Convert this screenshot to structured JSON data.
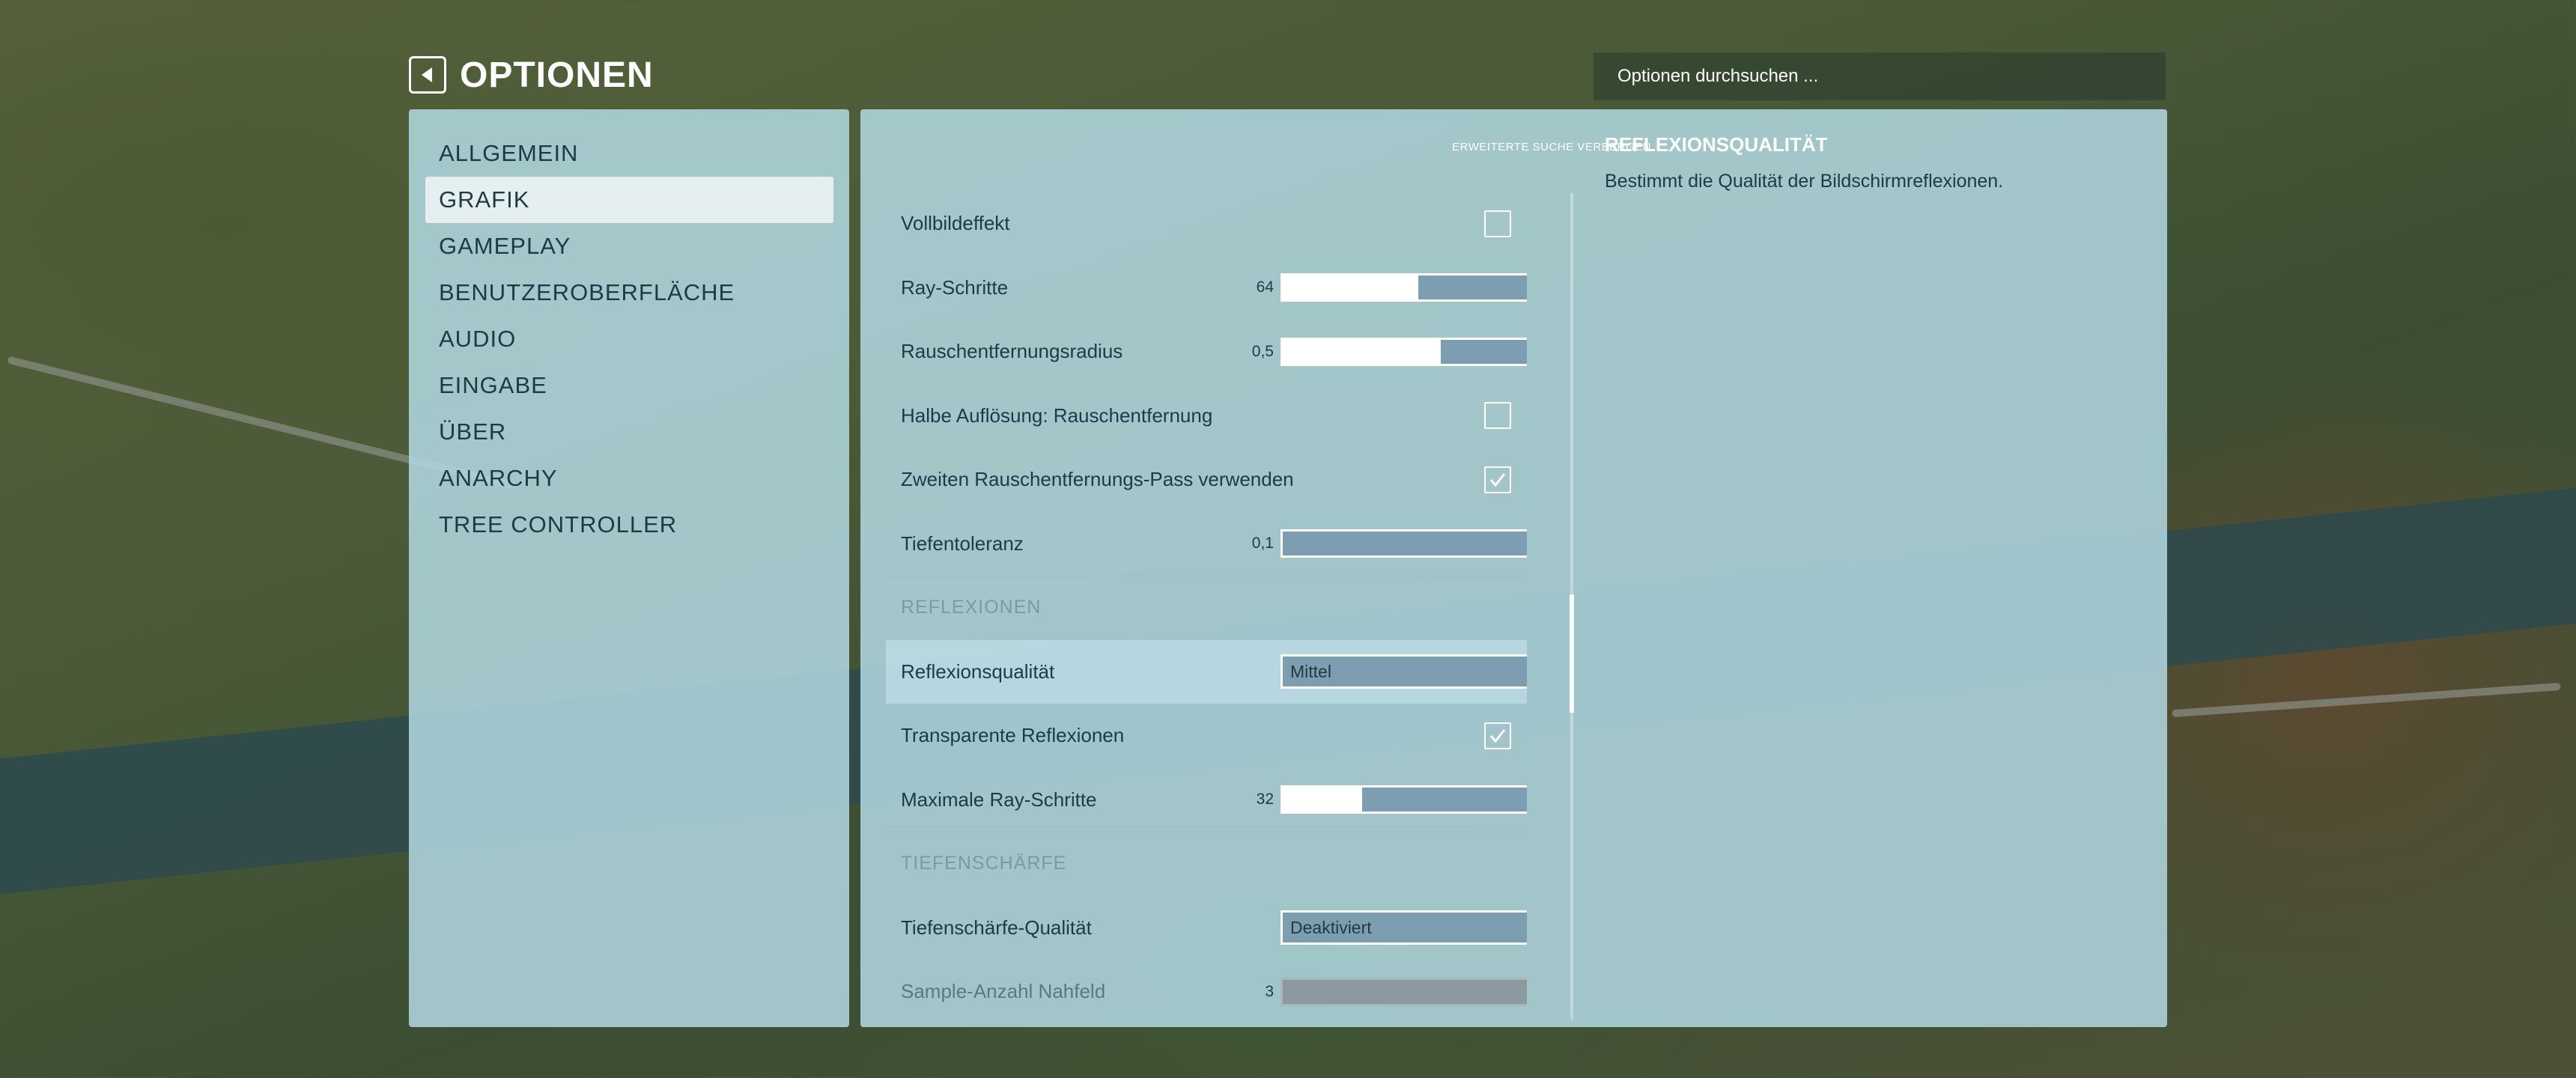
{
  "header": {
    "title": "OPTIONEN",
    "back_icon": "back-arrow-icon",
    "search_placeholder": "Optionen durchsuchen ..."
  },
  "sidebar": {
    "items": [
      {
        "label": "ALLGEMEIN",
        "active": false
      },
      {
        "label": "GRAFIK",
        "active": true
      },
      {
        "label": "GAMEPLAY",
        "active": false
      },
      {
        "label": "BENUTZEROBERFLÄCHE",
        "active": false
      },
      {
        "label": "AUDIO",
        "active": false
      },
      {
        "label": "EINGABE",
        "active": false
      },
      {
        "label": "ÜBER",
        "active": false
      },
      {
        "label": "ANARCHY",
        "active": false
      },
      {
        "label": "TREE CONTROLLER",
        "active": false
      }
    ]
  },
  "main": {
    "advanced_link": "ERWEITERTE SUCHE VERBERGEN",
    "settings": [
      {
        "type": "checkbox",
        "label": "Vollbildeffekt",
        "checked": false
      },
      {
        "type": "slider",
        "label": "Ray-Schritte",
        "value": "64",
        "fraction": 0.43
      },
      {
        "type": "slider",
        "label": "Rauschentfernungsradius",
        "value": "0,5",
        "fraction": 0.5
      },
      {
        "type": "checkbox",
        "label": "Halbe Auflösung: Rauschentfernung",
        "checked": false
      },
      {
        "type": "checkbox",
        "label": "Zweiten Rauschentfernungs-Pass verwenden",
        "checked": true
      },
      {
        "type": "slider",
        "label": "Tiefentoleranz",
        "value": "0,1",
        "fraction": 0.0
      },
      {
        "type": "section",
        "label": "REFLEXIONEN"
      },
      {
        "type": "dropdown",
        "label": "Reflexionsqualität",
        "value": "Mittel",
        "highlight": true
      },
      {
        "type": "checkbox",
        "label": "Transparente Reflexionen",
        "checked": true
      },
      {
        "type": "slider",
        "label": "Maximale Ray-Schritte",
        "value": "32",
        "fraction": 0.25
      },
      {
        "type": "section",
        "label": "TIEFENSCHÄRFE"
      },
      {
        "type": "dropdown",
        "label": "Tiefenschärfe-Qualität",
        "value": "Deaktiviert"
      },
      {
        "type": "slider",
        "label": "Sample-Anzahl Nahfeld",
        "value": "3",
        "fraction": 0.0,
        "disabled": true
      }
    ]
  },
  "description": {
    "title": "REFLEXIONSQUALITÄT",
    "text": "Bestimmt die Qualität der Bildschirmreflexionen."
  },
  "colors": {
    "panel": "#b2d8e2",
    "text": "#1e3a47",
    "slider_track": "#7d9db0",
    "white": "#ffffff"
  }
}
